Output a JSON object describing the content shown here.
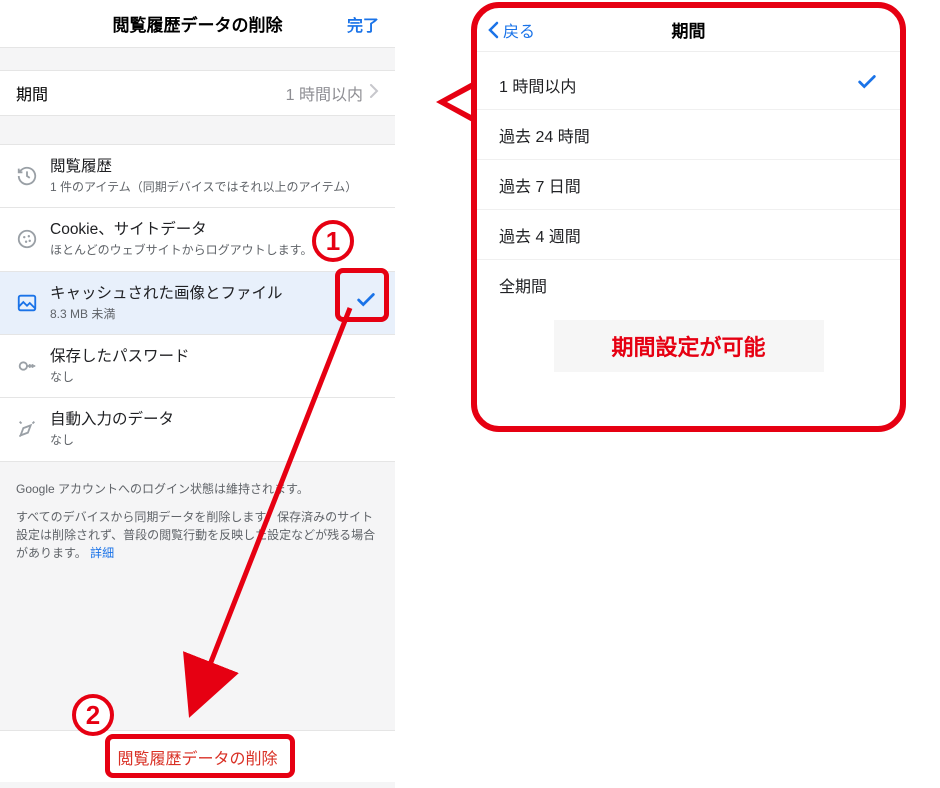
{
  "left": {
    "header": {
      "title": "閲覧履歴データの削除",
      "done": "完了"
    },
    "period": {
      "label": "期間",
      "value": "1 時間以内"
    },
    "rows": {
      "history": {
        "title": "閲覧履歴",
        "sub": "1 件のアイテム（同期デバイスではそれ以上のアイテム）"
      },
      "cookies": {
        "title": "Cookie、サイトデータ",
        "sub": "ほとんどのウェブサイトからログアウトします。"
      },
      "cache": {
        "title": "キャッシュされた画像とファイル",
        "sub": "8.3 MB 未満"
      },
      "passwords": {
        "title": "保存したパスワード",
        "sub": "なし"
      },
      "autofill": {
        "title": "自動入力のデータ",
        "sub": "なし"
      }
    },
    "footer1": "Google アカウントへのログイン状態は維持されます。",
    "footer2": "すべてのデバイスから同期データを削除します。保存済みのサイト設定は削除されず、普段の閲覧行動を反映した設定などが残る場合があります。",
    "footer_link": "詳細",
    "delete_button": "閲覧履歴データの削除"
  },
  "right": {
    "back": "戻る",
    "title": "期間",
    "options": [
      "1 時間以内",
      "過去 24 時間",
      "過去 7 日間",
      "過去 4 週間",
      "全期間"
    ],
    "selected_index": 0,
    "note": "期間設定が可能"
  },
  "annotations": {
    "circle1": "1",
    "circle2": "2"
  }
}
